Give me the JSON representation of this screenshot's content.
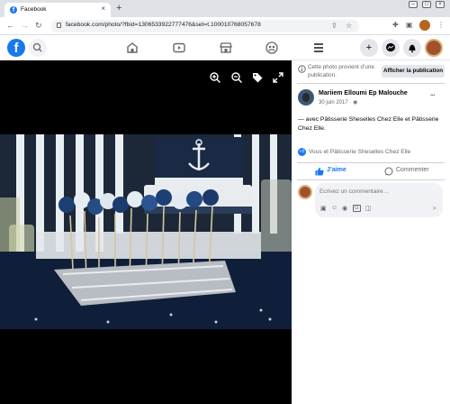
{
  "browser": {
    "tab_title": "Facebook",
    "new_tab": "+",
    "tab_close": "×",
    "url": "facebook.com/photo/?fbid=1306533922777476&set=t.100010768057678"
  },
  "colors": {
    "brand": "#1877f2",
    "panel_bg": "#ffffff",
    "viewer_bg": "#000000"
  },
  "fb_header": {
    "logo_letter": "f",
    "nav_icons": [
      "home-icon",
      "watch-icon",
      "marketplace-icon",
      "groups-icon",
      "menu-icon"
    ],
    "action_icons": [
      "plus-icon",
      "messenger-icon",
      "bell-icon",
      "avatar"
    ]
  },
  "photo_notice": {
    "text": "Cette photo provient d’une publication.",
    "button": "Afficher la publication"
  },
  "post": {
    "author": "Mariiem Elloumi Ep Malouche",
    "date": "30 juin 2017 ·",
    "more": "···",
    "caption": "— avec Pâtisserie Sheselles Chez Elle et Pâtisserie Chez Elle.",
    "reactions": "Vous et Pâtisserie Sheselles Chez Elle"
  },
  "actions": {
    "like": "J’aime",
    "comment": "Commenter"
  },
  "comment_box": {
    "placeholder": "Écrivez un commentaire…"
  }
}
